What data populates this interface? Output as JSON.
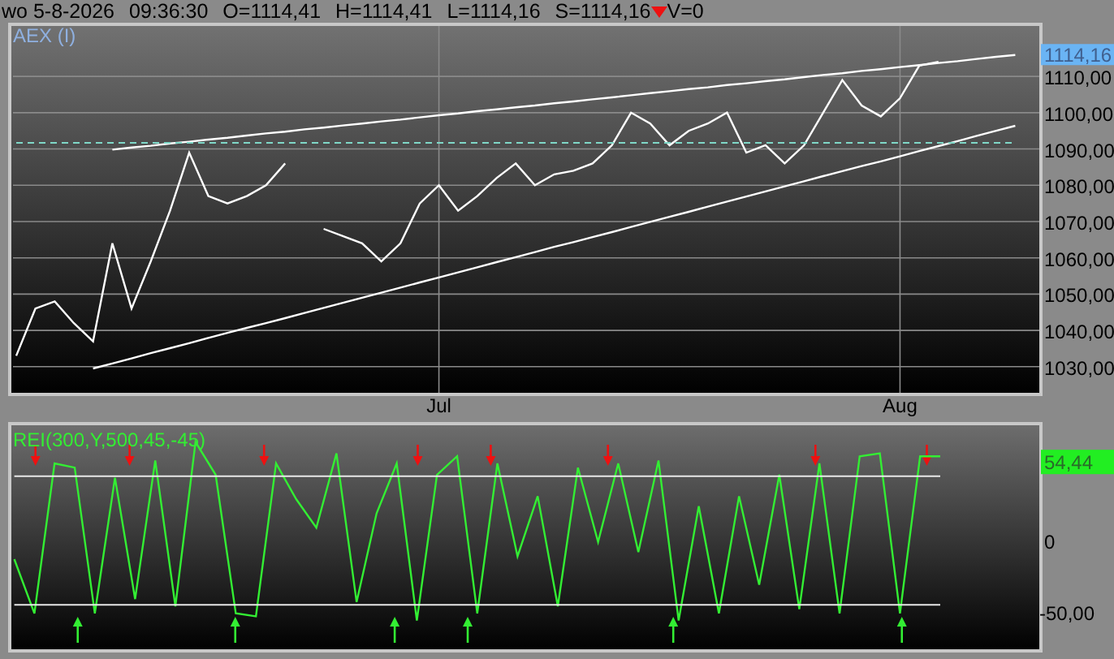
{
  "status_bar": {
    "date": "wo 5-8-2026",
    "time": "09:36:30",
    "open": "O=1114,41",
    "high": "H=1114,41",
    "low": "L=1114,16",
    "close": "S=1114,16",
    "falling": true,
    "volume": "V=0"
  },
  "price_chart": {
    "last_value_label": "1114,16",
    "chart_data": {
      "type": "line",
      "title": "AEX (I)",
      "categories": [
        null,
        null,
        null,
        null,
        null,
        null,
        null,
        null,
        null,
        null,
        null,
        null,
        null,
        null,
        null,
        null,
        null,
        null,
        null,
        null,
        null,
        null,
        "Jul",
        null,
        null,
        null,
        null,
        null,
        null,
        null,
        null,
        null,
        null,
        null,
        null,
        null,
        null,
        null,
        null,
        null,
        null,
        null,
        null,
        null,
        null,
        null,
        "Aug",
        null,
        null,
        null,
        null,
        null,
        null
      ],
      "series": [
        {
          "color": "#ffffff",
          "values": [
            1033,
            1046,
            1048,
            1042,
            1037,
            1064,
            1046,
            1059,
            1073,
            1089,
            1077,
            1075,
            1077,
            1080,
            1086,
            null,
            1068,
            1066,
            1064,
            1059,
            1064,
            1075,
            1080,
            1073,
            1077,
            1082,
            1086,
            1080,
            1083,
            1084,
            1086,
            1091,
            1100,
            1097,
            1091,
            1095,
            1097,
            1100,
            1089,
            1091,
            1086,
            1091,
            1100,
            1109,
            1102,
            1099,
            1104,
            1113,
            1114,
            null,
            null,
            null,
            null
          ]
        },
        {
          "color": "#ffffff",
          "values": [
            null,
            null,
            null,
            null,
            null,
            1089.8,
            1090.4,
            1090.9,
            1091.5,
            1092.0,
            1092.6,
            1093.1,
            1093.7,
            1094.3,
            1094.8,
            1095.4,
            1095.9,
            1096.5,
            1097.0,
            1097.6,
            1098.1,
            1098.7,
            1099.3,
            1099.8,
            1100.4,
            1100.9,
            1101.5,
            1102.0,
            1102.6,
            1103.1,
            1103.7,
            1104.2,
            1104.8,
            1105.4,
            1105.9,
            1106.5,
            1107.0,
            1107.6,
            1108.1,
            1108.7,
            1109.2,
            1109.8,
            1110.4,
            1110.9,
            1111.5,
            1112.0,
            1112.6,
            1113.1,
            1113.7,
            1114.2,
            1114.8,
            1115.4,
            1115.9
          ]
        },
        {
          "color": "#ffffff",
          "values": [
            null,
            null,
            null,
            null,
            1029.5,
            1030.9,
            1032.3,
            1033.7,
            1035.1,
            1036.5,
            1037.9,
            1039.3,
            1040.7,
            1042.0,
            1043.4,
            1044.8,
            1046.2,
            1047.6,
            1049.0,
            1050.4,
            1051.8,
            1053.2,
            1054.6,
            1056.0,
            1057.4,
            1058.8,
            1060.2,
            1061.6,
            1063.0,
            1064.3,
            1065.7,
            1067.1,
            1068.5,
            1069.9,
            1071.3,
            1072.7,
            1074.1,
            1075.5,
            1076.9,
            1078.3,
            1079.7,
            1081.1,
            1082.5,
            1083.9,
            1085.3,
            1086.6,
            1088.0,
            1089.4,
            1090.8,
            1092.2,
            1093.6,
            1095.0,
            1096.4
          ]
        },
        {
          "color": "#7fd8c8",
          "line_style": "dashed",
          "values": [
            1091.7,
            1091.7,
            1091.7,
            1091.7,
            1091.7,
            1091.7,
            1091.7,
            1091.7,
            1091.7,
            1091.7,
            1091.7,
            1091.7,
            1091.7,
            1091.7,
            1091.7,
            1091.7,
            1091.7,
            1091.7,
            1091.7,
            1091.7,
            1091.7,
            1091.7,
            1091.7,
            1091.7,
            1091.7,
            1091.7,
            1091.7,
            1091.7,
            1091.7,
            1091.7,
            1091.7,
            1091.7,
            1091.7,
            1091.7,
            1091.7,
            1091.7,
            1091.7,
            1091.7,
            1091.7,
            1091.7,
            1091.7,
            1091.7,
            1091.7,
            1091.7,
            1091.7,
            1091.7,
            1091.7,
            1091.7,
            1091.7,
            1091.7,
            1091.7,
            1091.7,
            1091.7
          ]
        }
      ],
      "grid": true,
      "ylim": [
        1022.8,
        1123.9
      ],
      "yticks": [
        {
          "value": 1030,
          "label": "1030,00"
        },
        {
          "value": 1040,
          "label": "1040,00"
        },
        {
          "value": 1050,
          "label": "1050,00"
        },
        {
          "value": 1060,
          "label": "1060,00"
        },
        {
          "value": 1070,
          "label": "1070,00"
        },
        {
          "value": 1080,
          "label": "1080,00"
        },
        {
          "value": 1090,
          "label": "1090,00"
        },
        {
          "value": 1100,
          "label": "1100,00"
        },
        {
          "value": 1110,
          "label": "1110,00"
        }
      ]
    }
  },
  "indicator": {
    "last_value_label": "54,44",
    "chart_data": {
      "type": "line",
      "title": "REI(300,Y,500,45,-45)",
      "categories": [
        null,
        null,
        null,
        null,
        null,
        null,
        null,
        null,
        null,
        null,
        null,
        null,
        null,
        null,
        null,
        null,
        null,
        null,
        null,
        null,
        null,
        null,
        null,
        null,
        null,
        null,
        null,
        null,
        null,
        null,
        null,
        null,
        null,
        null,
        null,
        null,
        null,
        null,
        null,
        null,
        null,
        null,
        null,
        null,
        null,
        null,
        null
      ],
      "series": [
        {
          "color": "#33ee33",
          "values": [
            -13,
            -51,
            54,
            51,
            -51,
            44,
            -41,
            56,
            -46,
            69,
            46,
            -51,
            -53,
            54,
            29,
            9,
            61,
            -43,
            19,
            54,
            -56,
            46,
            59,
            -51,
            54,
            -11,
            31,
            -46,
            51,
            -1,
            54,
            -8,
            56,
            -56,
            24,
            -51,
            31,
            -31,
            46,
            -48,
            54,
            -51,
            59,
            61,
            -51,
            59,
            59
          ]
        },
        {
          "color": "#e8e8e8",
          "values": [
            45,
            45,
            45,
            45,
            45,
            45,
            45,
            45,
            45,
            45,
            45,
            45,
            45,
            45,
            45,
            45,
            45,
            45,
            45,
            45,
            45,
            45,
            45,
            45,
            45,
            45,
            45,
            45,
            45,
            45,
            45,
            45,
            45,
            45,
            45,
            45,
            45,
            45,
            45,
            45,
            45,
            45,
            45,
            45,
            45,
            45,
            45
          ]
        },
        {
          "color": "#e8e8e8",
          "values": [
            -45,
            -45,
            -45,
            -45,
            -45,
            -45,
            -45,
            -45,
            -45,
            -45,
            -45,
            -45,
            -45,
            -45,
            -45,
            -45,
            -45,
            -45,
            -45,
            -45,
            -45,
            -45,
            -45,
            -45,
            -45,
            -45,
            -45,
            -45,
            -45,
            -45,
            -45,
            -45,
            -45,
            -45,
            -45,
            -45,
            -45,
            -45,
            -45,
            -45,
            -45,
            -45,
            -45,
            -45,
            -45,
            -45,
            -45
          ]
        }
      ],
      "ylim": [
        -76.1,
        80.7
      ],
      "yticks": [
        {
          "value": 0,
          "label": "0"
        },
        {
          "value": -50,
          "label": "-50,00"
        }
      ]
    }
  }
}
